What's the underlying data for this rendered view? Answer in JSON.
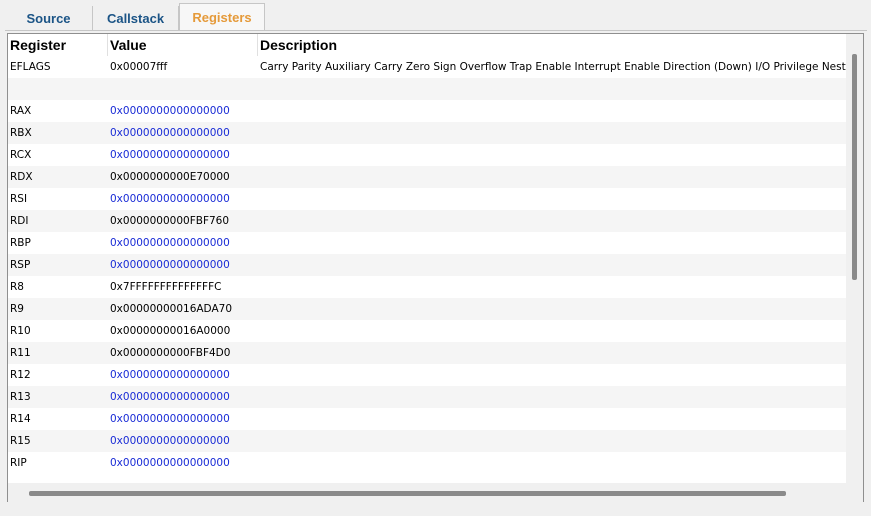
{
  "tabs": [
    {
      "label": "Source",
      "active": false
    },
    {
      "label": "Callstack",
      "active": false
    },
    {
      "label": "Registers",
      "active": true
    }
  ],
  "table": {
    "columns": [
      "Register",
      "Value",
      "Description"
    ],
    "rows": [
      {
        "name": "EFLAGS",
        "value": "0x00007fff",
        "description": "Carry Parity Auxiliary Carry Zero Sign Overflow Trap Enable Interrupt Enable Direction (Down) I/O Privilege Nested T",
        "zero": false
      },
      {
        "name": "",
        "value": "",
        "description": "",
        "zero": false
      },
      {
        "name": "RAX",
        "value": "0x0000000000000000",
        "description": "",
        "zero": true
      },
      {
        "name": "RBX",
        "value": "0x0000000000000000",
        "description": "",
        "zero": true
      },
      {
        "name": "RCX",
        "value": "0x0000000000000000",
        "description": "",
        "zero": true
      },
      {
        "name": "RDX",
        "value": "0x0000000000E70000",
        "description": "",
        "zero": false
      },
      {
        "name": "RSI",
        "value": "0x0000000000000000",
        "description": "",
        "zero": true
      },
      {
        "name": "RDI",
        "value": "0x0000000000FBF760",
        "description": "",
        "zero": false
      },
      {
        "name": "RBP",
        "value": "0x0000000000000000",
        "description": "",
        "zero": true
      },
      {
        "name": "RSP",
        "value": "0x0000000000000000",
        "description": "",
        "zero": true
      },
      {
        "name": "R8",
        "value": "0x7FFFFFFFFFFFFFFC",
        "description": "",
        "zero": false
      },
      {
        "name": "R9",
        "value": "0x00000000016ADA70",
        "description": "",
        "zero": false
      },
      {
        "name": "R10",
        "value": "0x00000000016A0000",
        "description": "",
        "zero": false
      },
      {
        "name": "R11",
        "value": "0x0000000000FBF4D0",
        "description": "",
        "zero": false
      },
      {
        "name": "R12",
        "value": "0x0000000000000000",
        "description": "",
        "zero": true
      },
      {
        "name": "R13",
        "value": "0x0000000000000000",
        "description": "",
        "zero": true
      },
      {
        "name": "R14",
        "value": "0x0000000000000000",
        "description": "",
        "zero": true
      },
      {
        "name": "R15",
        "value": "0x0000000000000000",
        "description": "",
        "zero": true
      },
      {
        "name": "RIP",
        "value": "0x0000000000000000",
        "description": "",
        "zero": true
      }
    ]
  },
  "colors": {
    "active_tab": "#e59a3a",
    "inactive_tab": "#1b5486",
    "zero_value": "#1a2cd6"
  }
}
